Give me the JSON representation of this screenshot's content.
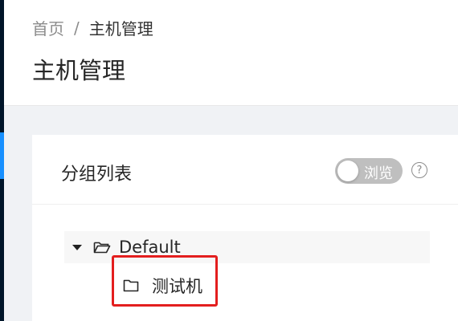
{
  "breadcrumb": {
    "home": "首页",
    "separator": "/",
    "current": "主机管理"
  },
  "page": {
    "title": "主机管理"
  },
  "card": {
    "title": "分组列表",
    "toggle_label": "浏览",
    "toggle_on": false,
    "help_icon": "question-circle-icon"
  },
  "tree": {
    "root": {
      "label": "Default",
      "expanded": true,
      "icon": "folder-open-icon"
    },
    "children": [
      {
        "label": "测试机",
        "icon": "folder-icon"
      }
    ]
  },
  "colors": {
    "accent": "#1890ff",
    "sidebar": "#001529",
    "highlight": "#e31e1e"
  }
}
